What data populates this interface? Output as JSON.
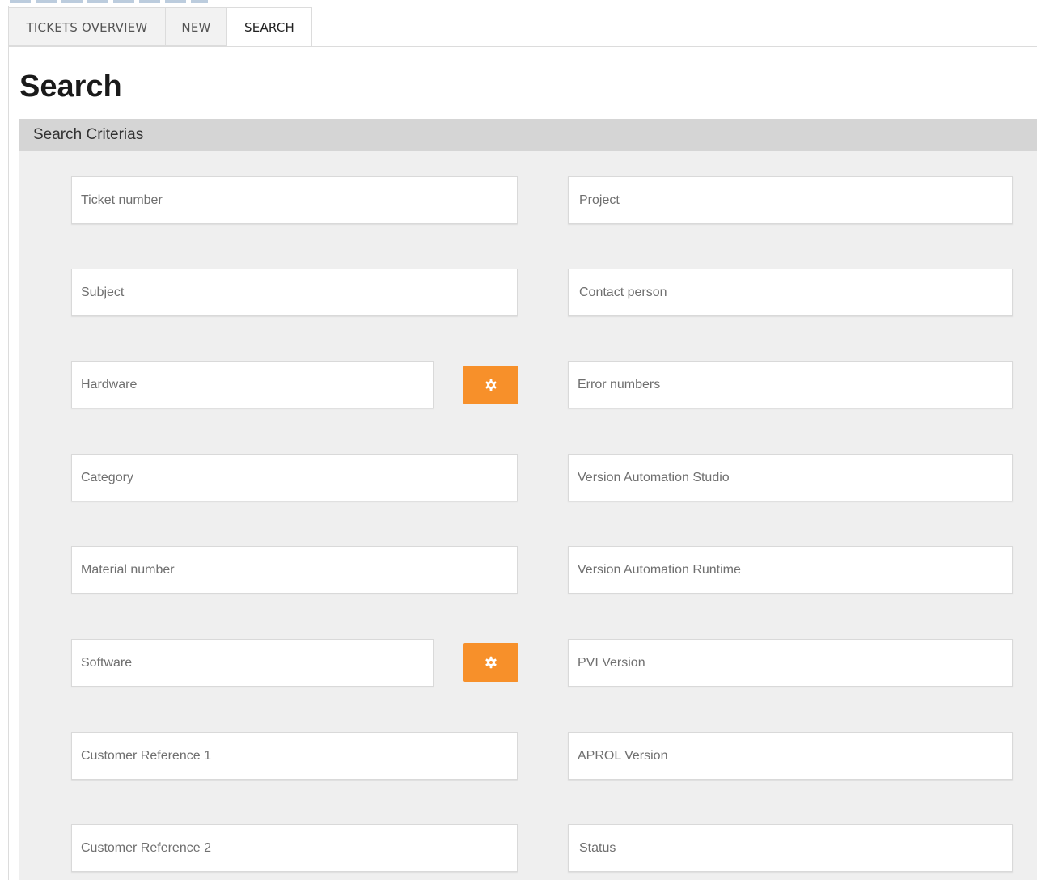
{
  "tabs": [
    {
      "label": "TICKETS OVERVIEW"
    },
    {
      "label": "NEW"
    },
    {
      "label": "SEARCH"
    }
  ],
  "page": {
    "title": "Search"
  },
  "panel": {
    "header": "Search Criterias"
  },
  "fields": {
    "ticket_number": {
      "placeholder": "Ticket number"
    },
    "project": {
      "placeholder": "Project"
    },
    "subject": {
      "placeholder": "Subject"
    },
    "contact_person": {
      "placeholder": "Contact person"
    },
    "hardware": {
      "placeholder": "Hardware"
    },
    "error_numbers": {
      "placeholder": "Error numbers"
    },
    "category": {
      "placeholder": "Category"
    },
    "version_automation_studio": {
      "placeholder": "Version Automation Studio"
    },
    "material_number": {
      "placeholder": "Material number"
    },
    "version_automation_runtime": {
      "placeholder": "Version Automation Runtime"
    },
    "software": {
      "placeholder": "Software"
    },
    "pvi_version": {
      "placeholder": "PVI Version"
    },
    "customer_reference_1": {
      "placeholder": "Customer Reference 1"
    },
    "aprol_version": {
      "placeholder": "APROL Version"
    },
    "customer_reference_2": {
      "placeholder": "Customer Reference 2"
    },
    "status": {
      "placeholder": "Status"
    }
  },
  "icons": {
    "hardware_button": "gear-icon",
    "software_button": "gear-icon"
  },
  "colors": {
    "accent": "#f7902a",
    "panel_background": "#efefef",
    "panel_header": "#d5d5d5"
  }
}
